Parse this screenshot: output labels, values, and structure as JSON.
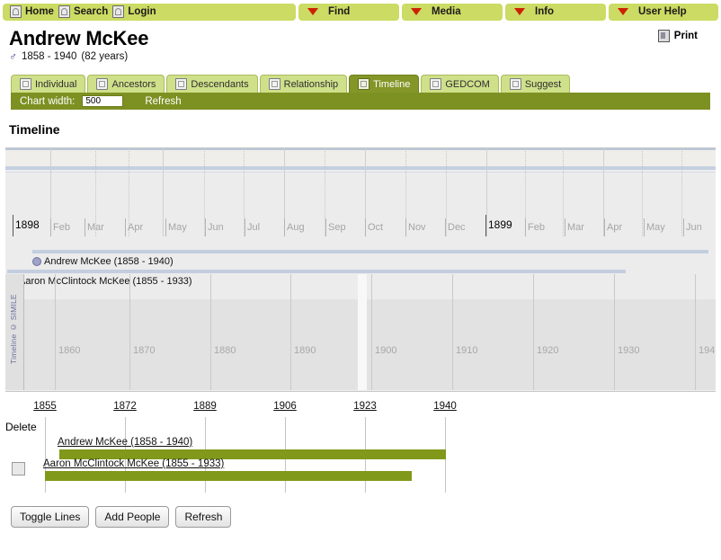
{
  "topnav": {
    "left_items": [
      {
        "label": "Home",
        "icon": "home-icon"
      },
      {
        "label": "Search",
        "icon": "search-icon"
      },
      {
        "label": "Login",
        "icon": "login-icon"
      }
    ],
    "menus": [
      {
        "label": "Find"
      },
      {
        "label": "Media"
      },
      {
        "label": "Info"
      },
      {
        "label": "User Help"
      }
    ]
  },
  "person": {
    "name": "Andrew McKee",
    "sex_symbol": "♂",
    "lifespan": "1858 - 1940",
    "age": "(82 years)"
  },
  "print": {
    "label": "Print"
  },
  "tabs": [
    {
      "label": "Individual",
      "active": false
    },
    {
      "label": "Ancestors",
      "active": false
    },
    {
      "label": "Descendants",
      "active": false
    },
    {
      "label": "Relationship",
      "active": false
    },
    {
      "label": "Timeline",
      "active": true
    },
    {
      "label": "GEDCOM",
      "active": false
    },
    {
      "label": "Suggest",
      "active": false
    }
  ],
  "controlbar": {
    "chart_width_label": "Chart width:",
    "chart_width_value": "500",
    "refresh_label": "Refresh"
  },
  "section": {
    "heading": "Timeline"
  },
  "chart_data": {
    "type": "table",
    "title": "Timeline",
    "simile": {
      "copyright": "Timeline © SIMILE",
      "main_band": {
        "unit": "month",
        "year_markers": [
          "1898",
          "1899"
        ],
        "month_ticks": [
          "Feb",
          "Mar",
          "Apr",
          "May",
          "Jun",
          "Jul",
          "Aug",
          "Sep",
          "Oct",
          "Nov",
          "Dec",
          "Feb",
          "Mar",
          "Apr",
          "May",
          "Jun"
        ]
      },
      "overview_band": {
        "unit": "decade",
        "ticks": [
          "1860",
          "1870",
          "1880",
          "1890",
          "1900",
          "1910",
          "1920",
          "1930",
          "194"
        ]
      },
      "events": [
        {
          "label": "Andrew McKee (1858 - 1940)",
          "indent": 30,
          "bar_start": 40,
          "bar_end": 770
        },
        {
          "label": "Aaron McClintock McKee (1855 - 1933)",
          "indent": 2,
          "bar_start": 2,
          "bar_end": 690
        }
      ]
    },
    "gantt": {
      "delete_label": "Delete",
      "axis_ticks": [
        "1855",
        "1872",
        "1889",
        "1906",
        "1923",
        "1940"
      ],
      "axis_min": 1855,
      "axis_max": 1940,
      "rows": [
        {
          "label": "Andrew McKee (1858 - 1940)",
          "start": 1858,
          "end": 1940,
          "checkbox": false
        },
        {
          "label": "Aaron McClintock McKee (1855 - 1933)",
          "start": 1855,
          "end": 1933,
          "checkbox": true
        }
      ]
    }
  },
  "buttons": [
    {
      "label": "Toggle Lines"
    },
    {
      "label": "Add People"
    },
    {
      "label": "Refresh"
    }
  ],
  "colors": {
    "nav_green": "#ccdb63",
    "tab_green": "#cfe08a",
    "tab_active": "#839627",
    "ctrlbar": "#7d9022",
    "bar_green": "#80991a",
    "triangle_red": "#cc2200",
    "event_blue": "#c3cede"
  }
}
